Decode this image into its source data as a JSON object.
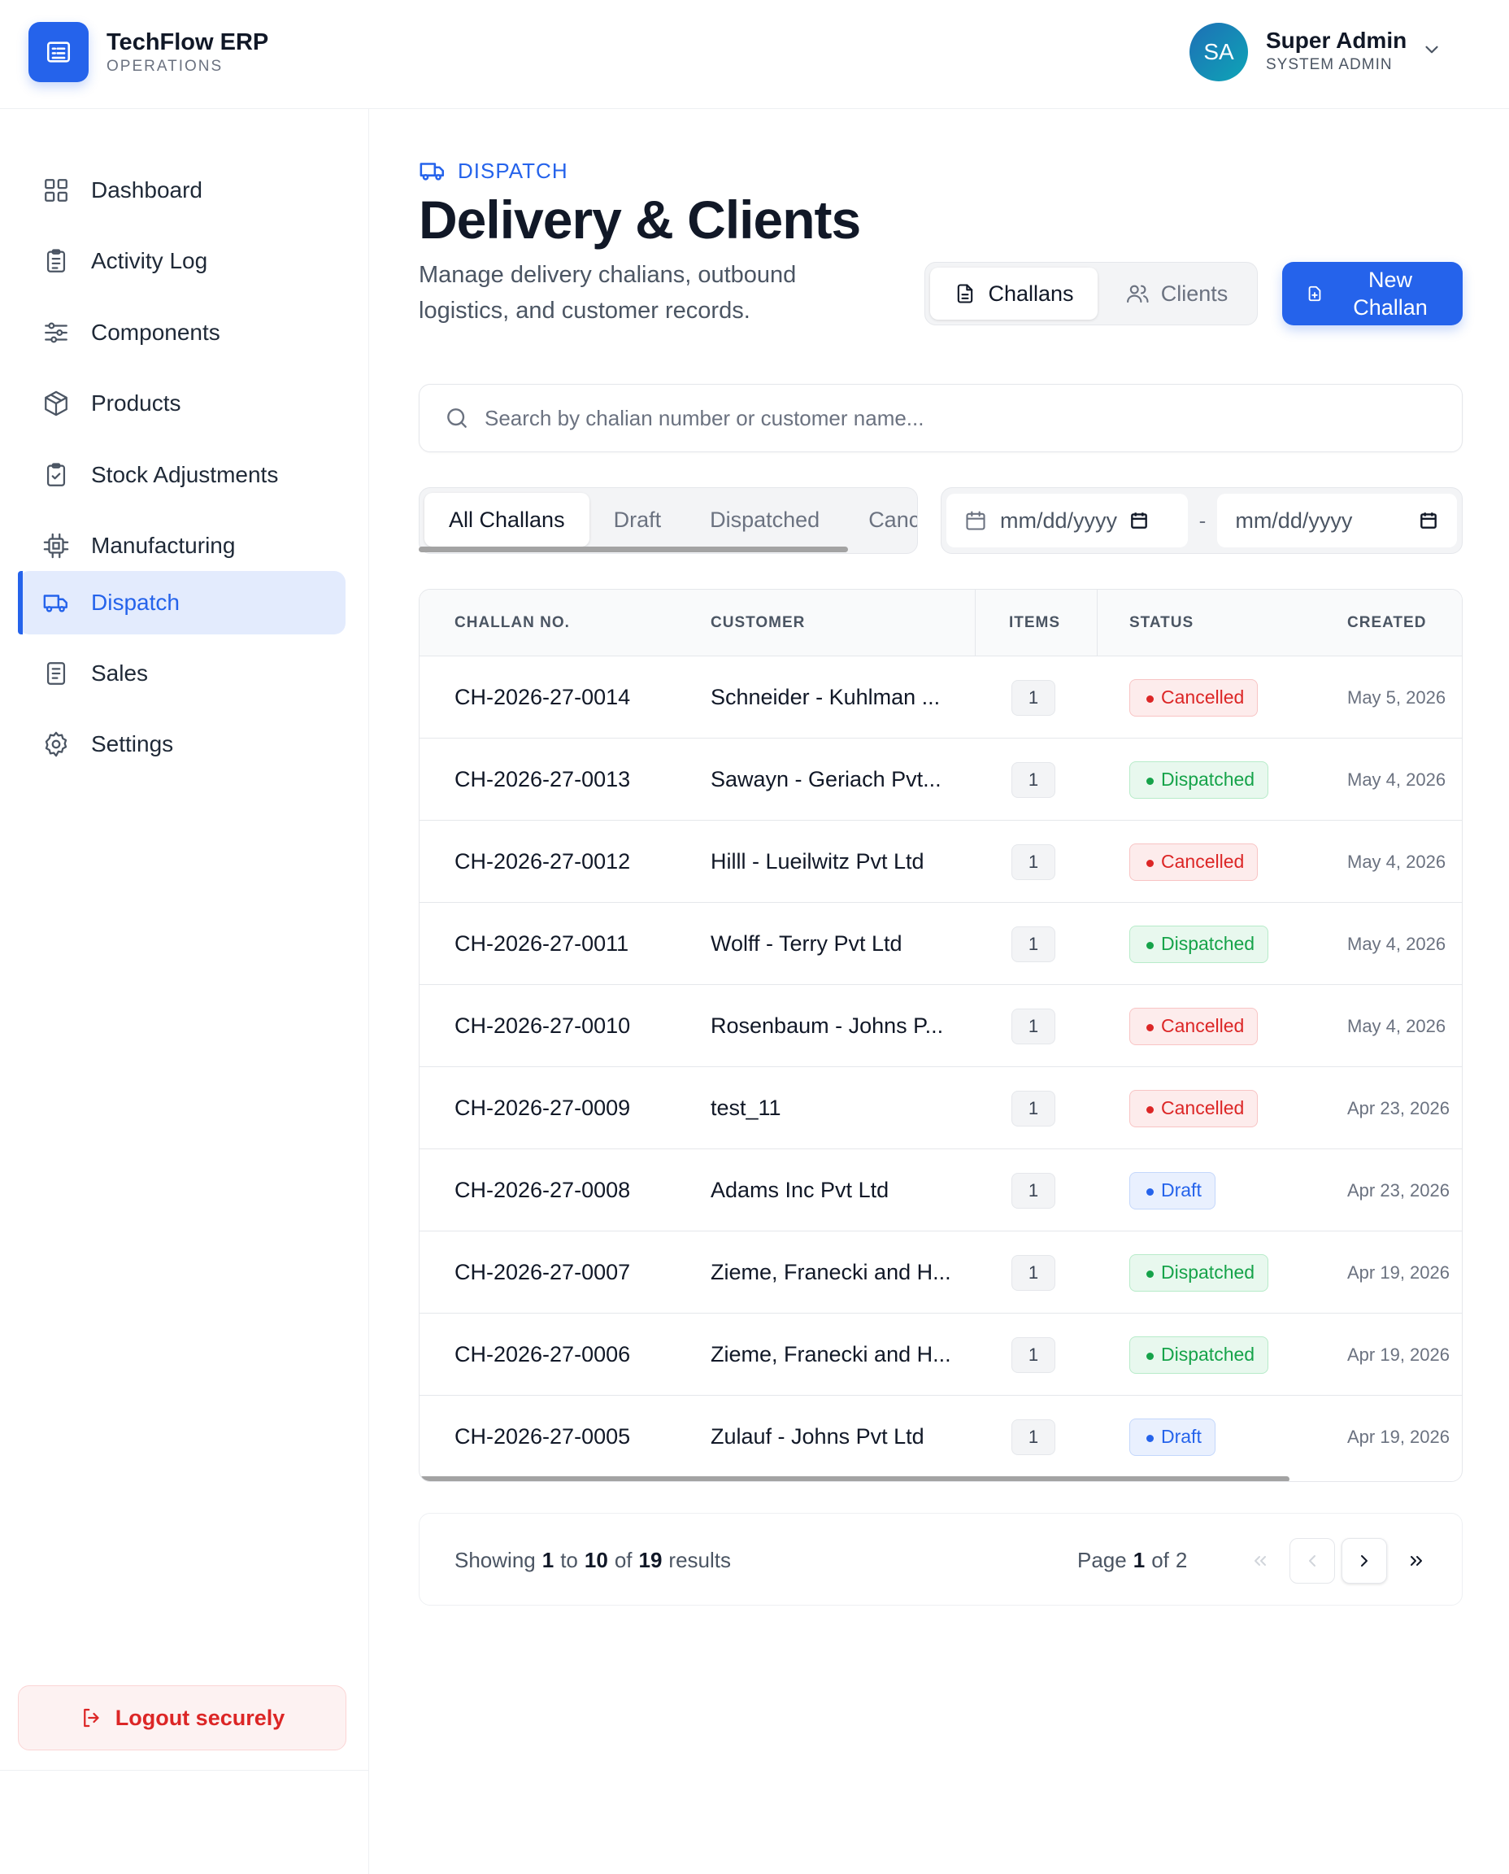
{
  "app": {
    "name": "TechFlow ERP",
    "subtitle": "OPERATIONS"
  },
  "user": {
    "initials": "SA",
    "name": "Super Admin",
    "role": "SYSTEM ADMIN"
  },
  "sidebar": {
    "items": [
      {
        "label": "Dashboard",
        "icon": "dashboard-icon"
      },
      {
        "label": "Activity Log",
        "icon": "clipboard-icon"
      },
      {
        "label": "Components",
        "icon": "sliders-icon"
      },
      {
        "label": "Products",
        "icon": "box-icon"
      },
      {
        "label": "Stock Adjustments",
        "icon": "clipboard-check-icon"
      },
      {
        "label": "Manufacturing",
        "icon": "cpu-icon"
      },
      {
        "label": "Dispatch",
        "icon": "truck-icon",
        "active": true
      },
      {
        "label": "Sales",
        "icon": "receipt-icon"
      },
      {
        "label": "Settings",
        "icon": "gear-icon"
      }
    ],
    "logout_label": "Logout securely"
  },
  "page": {
    "breadcrumb": "DISPATCH",
    "title": "Delivery & Clients",
    "description": "Manage delivery chalians, outbound logistics, and customer records.",
    "view_tabs": [
      "Challans",
      "Clients"
    ],
    "new_button": "New Challan"
  },
  "search": {
    "placeholder": "Search by chalian number or customer name..."
  },
  "filters": {
    "tabs": [
      "All Challans",
      "Draft",
      "Dispatched",
      "Canc"
    ],
    "date_placeholder": "mm/dd/yyyy",
    "date_separator": "-"
  },
  "table": {
    "columns": [
      "CHALLAN NO.",
      "CUSTOMER",
      "ITEMS",
      "STATUS",
      "CREATED"
    ],
    "rows": [
      {
        "no": "CH-2026-27-0014",
        "customer": "Schneider - Kuhlman ...",
        "items": "1",
        "status": "Cancelled",
        "created": "May 5, 2026"
      },
      {
        "no": "CH-2026-27-0013",
        "customer": "Sawayn - Geriach Pvt...",
        "items": "1",
        "status": "Dispatched",
        "created": "May 4, 2026"
      },
      {
        "no": "CH-2026-27-0012",
        "customer": "Hilll - Lueilwitz Pvt Ltd",
        "items": "1",
        "status": "Cancelled",
        "created": "May 4, 2026"
      },
      {
        "no": "CH-2026-27-0011",
        "customer": "Wolff - Terry Pvt Ltd",
        "items": "1",
        "status": "Dispatched",
        "created": "May 4, 2026"
      },
      {
        "no": "CH-2026-27-0010",
        "customer": "Rosenbaum - Johns P...",
        "items": "1",
        "status": "Cancelled",
        "created": "May 4, 2026"
      },
      {
        "no": "CH-2026-27-0009",
        "customer": "test_11",
        "items": "1",
        "status": "Cancelled",
        "created": "Apr 23, 2026"
      },
      {
        "no": "CH-2026-27-0008",
        "customer": "Adams Inc Pvt Ltd",
        "items": "1",
        "status": "Draft",
        "created": "Apr 23, 2026"
      },
      {
        "no": "CH-2026-27-0007",
        "customer": "Zieme, Franecki and H...",
        "items": "1",
        "status": "Dispatched",
        "created": "Apr 19, 2026"
      },
      {
        "no": "CH-2026-27-0006",
        "customer": "Zieme, Franecki and H...",
        "items": "1",
        "status": "Dispatched",
        "created": "Apr 19, 2026"
      },
      {
        "no": "CH-2026-27-0005",
        "customer": "Zulauf - Johns Pvt Ltd",
        "items": "1",
        "status": "Draft",
        "created": "Apr 19, 2026"
      }
    ]
  },
  "pagination": {
    "showing_prefix": "Showing",
    "from": "1",
    "to_word": "to",
    "to": "10",
    "of_word": "of",
    "total": "19",
    "suffix": "results",
    "page_word": "Page",
    "page": "1",
    "page_of": "of",
    "pages": "2"
  },
  "colors": {
    "accent": "#2563eb",
    "cancelled": "#dc2626",
    "dispatched": "#16a34a",
    "draft": "#2563eb"
  }
}
